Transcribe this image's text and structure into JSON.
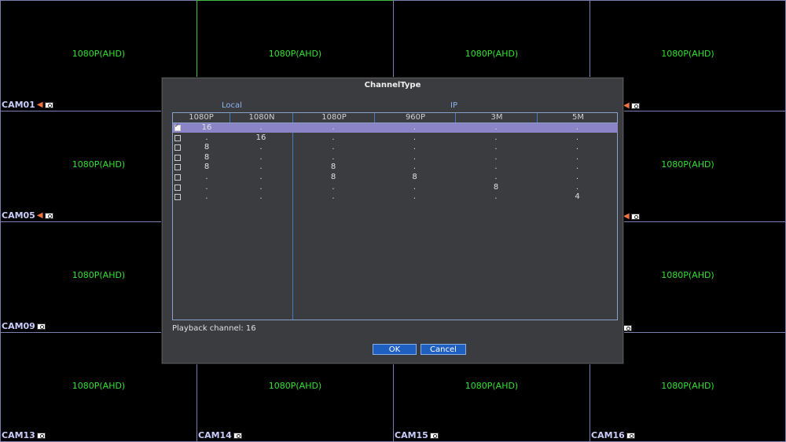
{
  "cameras": [
    {
      "label": "CAM01",
      "res": "1080P(AHD)",
      "mic": true
    },
    {
      "label": "",
      "res": "1080P(AHD)",
      "mic": false
    },
    {
      "label": "",
      "res": "1080P(AHD)",
      "mic": false
    },
    {
      "label": "",
      "res": "1080P(AHD)",
      "mic": true
    },
    {
      "label": "CAM05",
      "res": "1080P(AHD)",
      "mic": true
    },
    {
      "label": "",
      "res": "",
      "mic": false
    },
    {
      "label": "",
      "res": "",
      "mic": false
    },
    {
      "label": "",
      "res": "1080P(AHD)",
      "mic": true
    },
    {
      "label": "CAM09",
      "res": "1080P(AHD)",
      "mic": false
    },
    {
      "label": "",
      "res": "",
      "mic": false
    },
    {
      "label": "",
      "res": "",
      "mic": false
    },
    {
      "label": "",
      "res": "1080P(AHD)",
      "mic": false
    },
    {
      "label": "CAM13",
      "res": "1080P(AHD)",
      "mic": false
    },
    {
      "label": "CAM14",
      "res": "1080P(AHD)",
      "mic": false
    },
    {
      "label": "CAM15",
      "res": "1080P(AHD)",
      "mic": false
    },
    {
      "label": "CAM16",
      "res": "1080P(AHD)",
      "mic": false
    }
  ],
  "dialog": {
    "title": "ChannelType",
    "group_local": "Local",
    "group_ip": "IP",
    "columns": [
      "1080P",
      "1080N",
      "1080P",
      "960P",
      "3M",
      "5M"
    ],
    "rows": [
      {
        "checked": true,
        "values": [
          "16",
          ".",
          ".",
          ".",
          ".",
          "."
        ]
      },
      {
        "checked": false,
        "values": [
          ".",
          "16",
          ".",
          ".",
          ".",
          "."
        ]
      },
      {
        "checked": false,
        "values": [
          "8",
          ".",
          ".",
          ".",
          ".",
          "."
        ]
      },
      {
        "checked": false,
        "values": [
          "8",
          ".",
          ".",
          ".",
          ".",
          "."
        ]
      },
      {
        "checked": false,
        "values": [
          "8",
          ".",
          "8",
          ".",
          ".",
          "."
        ]
      },
      {
        "checked": false,
        "values": [
          ".",
          ".",
          "8",
          "8",
          ".",
          "."
        ]
      },
      {
        "checked": false,
        "values": [
          ".",
          ".",
          ".",
          ".",
          "8",
          "."
        ]
      },
      {
        "checked": false,
        "values": [
          ".",
          ".",
          ".",
          ".",
          ".",
          "4"
        ]
      }
    ],
    "playback_label": "Playback channel: 16",
    "ok_label": "OK",
    "cancel_label": "Cancel"
  }
}
